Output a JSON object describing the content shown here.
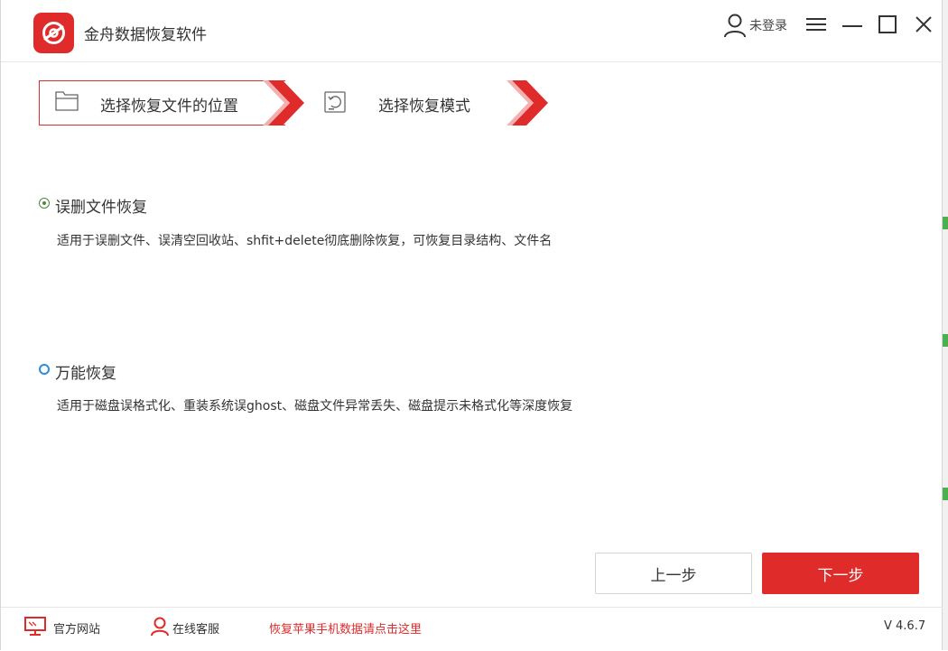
{
  "app": {
    "title": "金舟数据恢复软件",
    "login": "未登录"
  },
  "steps": [
    {
      "label": "选择恢复文件的位置"
    },
    {
      "label": "选择恢复模式"
    }
  ],
  "options": [
    {
      "title": "误删文件恢复",
      "desc": "适用于误删文件、误清空回收站、shfit+delete彻底删除恢复，可恢复目录结构、文件名",
      "selected": true
    },
    {
      "title": "万能恢复",
      "desc": "适用于磁盘误格式化、重装系统误ghost、磁盘文件异常丢失、磁盘提示未格式化等深度恢复",
      "selected": false
    }
  ],
  "buttons": {
    "prev": "上一步",
    "next": "下一步"
  },
  "footer": {
    "site": "官方网站",
    "service": "在线客服",
    "promo": "恢复苹果手机数据请点击这里",
    "version": "V 4.6.7"
  },
  "colors": {
    "accent": "#e02b2b",
    "radio_on": "#4a8a3a",
    "radio_off": "#2b8ce0"
  }
}
